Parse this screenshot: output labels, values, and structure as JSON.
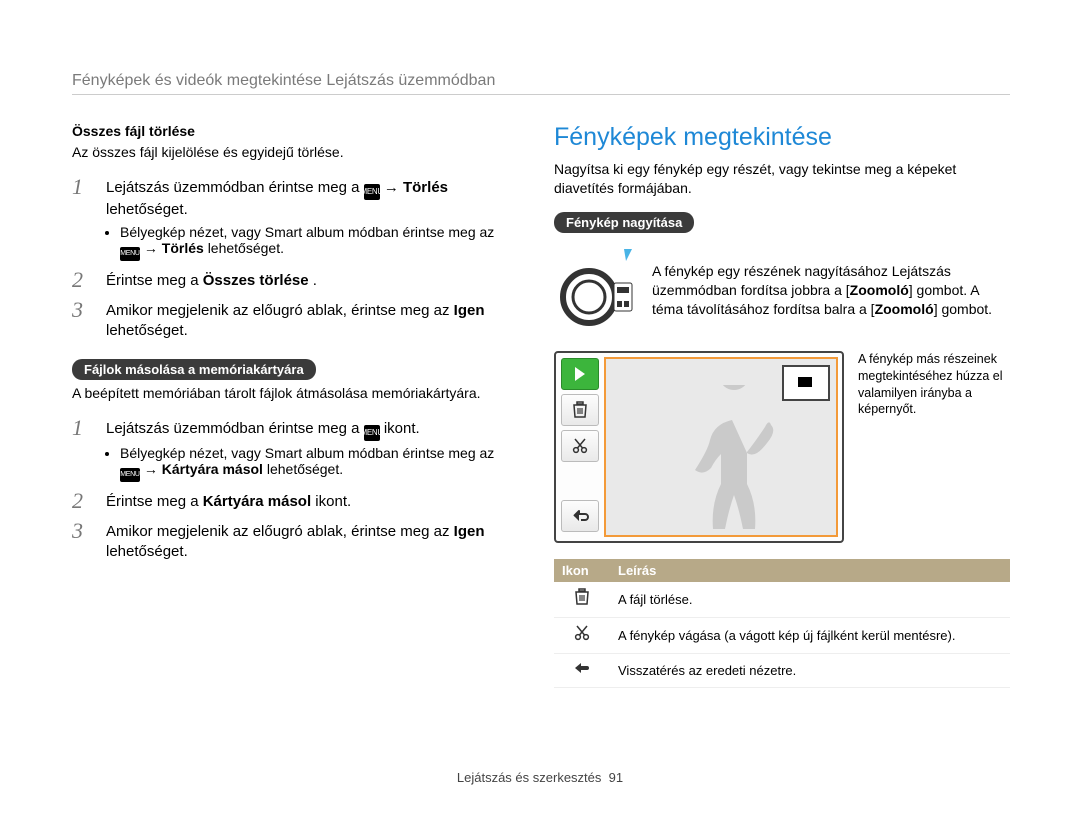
{
  "breadcrumb": "Fényképek és videók megtekintése Lejátszás üzemmódban",
  "left": {
    "sectionA": {
      "heading": "Összes fájl törlése",
      "desc": "Az összes fájl kijelölése és egyidejű törlése.",
      "step1": {
        "num": "1",
        "pre": "Lejátszás üzemmódban érintse meg a ",
        "menu": "m",
        "arrow": " → ",
        "boldTarget": "Törlés",
        "post": " lehetőséget.",
        "sub": {
          "pre": "Bélyegkép nézet, vagy Smart album módban érintse meg az ",
          "arrow2": " → ",
          "bold": "Törlés",
          "post2": " lehetőséget."
        }
      },
      "step2": {
        "num": "2",
        "pre": "Érintse meg a ",
        "bold": "Összes törlése",
        "post": "."
      },
      "step3": {
        "num": "3",
        "pre": "Amikor megjelenik az előugró ablak, érintse meg az ",
        "bold": "Igen",
        "post": " lehetőséget."
      }
    },
    "sectionB": {
      "pill": "Fájlok másolása a memóriakártyára",
      "desc": "A beépített memóriában tárolt fájlok átmásolása memóriakártyára.",
      "step1": {
        "num": "1",
        "pre": "Lejátszás üzemmódban érintse meg a ",
        "menu": "m",
        "post": " ikont.",
        "sub": {
          "pre": "Bélyegkép nézet, vagy Smart album módban érintse meg az ",
          "arrow2": " → ",
          "bold": "Kártyára másol",
          "post2": " lehetőséget."
        }
      },
      "step2": {
        "num": "2",
        "pre": "Érintse meg a ",
        "bold": "Kártyára másol",
        "post": " ikont."
      },
      "step3": {
        "num": "3",
        "pre": "Amikor megjelenik az előugró ablak, érintse meg az ",
        "bold": "Igen",
        "post": " lehetőséget."
      }
    }
  },
  "right": {
    "title": "Fényképek megtekintése",
    "intro": "Nagyítsa ki egy fénykép egy részét, vagy tekintse meg a képeket diavetítés formájában.",
    "zoom": {
      "pill": "Fénykép nagyítása",
      "desc_pre": "A fénykép egy részének nagyításához Lejátszás üzemmódban fordítsa jobbra a [",
      "knob1": "Zoomoló",
      "desc_mid": "] gombot. A téma távolításához fordítsa balra a [",
      "knob2": "Zoomoló",
      "desc_post": "] gombot."
    },
    "callout": "A fénykép más részeinek megtekintéséhez húzza el valamilyen irányba a képernyőt.",
    "table": {
      "head_icon": "Ikon",
      "head_desc": "Leírás",
      "rows": [
        {
          "icon": "trash",
          "desc": "A fájl törlése."
        },
        {
          "icon": "scissors",
          "desc": "A fénykép vágása (a vágott kép új fájlként kerül mentésre)."
        },
        {
          "icon": "return",
          "desc": "Visszatérés az eredeti nézetre."
        }
      ]
    }
  },
  "footer": {
    "section": "Lejátszás és szerkesztés",
    "page": "91"
  },
  "menuGlyph": "MENU"
}
